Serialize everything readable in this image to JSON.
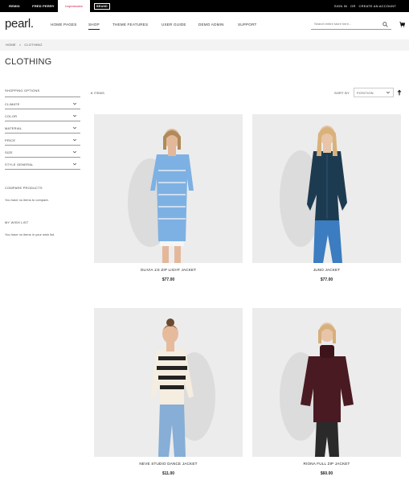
{
  "top_brands": [
    "REMIX",
    "FRED PERRY",
    "hopemania",
    "BRAND"
  ],
  "account": {
    "sign_in": "SIGN IN",
    "or": "OR",
    "create": "CREATE AN ACCOUNT"
  },
  "logo": "pearl.",
  "nav": [
    "HOME PAGES",
    "SHOP",
    "THEME FEATURES",
    "USER GUIDE",
    "DEMO ADMIN",
    "SUPPORT"
  ],
  "search": {
    "placeholder": "Search entire store here..."
  },
  "breadcrumb": {
    "home": "HOME",
    "separator": ">",
    "current": "CLOTHING"
  },
  "page_title": "CLOTHING",
  "sidebar": {
    "heading": "SHOPPING OPTIONS",
    "filters": [
      "CLIMATE",
      "COLOR",
      "MATERIAL",
      "PRICE",
      "SIZE",
      "STYLE GENERAL"
    ],
    "compare_title": "COMPARE PRODUCTS",
    "compare_text": "You have no items to compare.",
    "wishlist_title": "MY WISH LIST",
    "wishlist_text": "You have no items in your wish list."
  },
  "toolbar": {
    "items": "8 ITEMS",
    "sort_label": "SORT BY",
    "sort_value": "POSITION"
  },
  "products": [
    {
      "name": "OLIVIA 1/4 ZIP LIGHT JACKET",
      "price": "$77.00"
    },
    {
      "name": "JUNO JACKET",
      "price": "$77.00"
    },
    {
      "name": "NEVE STUDIO DANCE JACKET",
      "price": "$11.00"
    },
    {
      "name": "RIONA FULL ZIP JACKET",
      "price": "$60.00"
    }
  ],
  "colors": {
    "topbar": "#000000",
    "breadcrumb_bg": "#f3f3f3",
    "photo_bg": "#ececec"
  }
}
